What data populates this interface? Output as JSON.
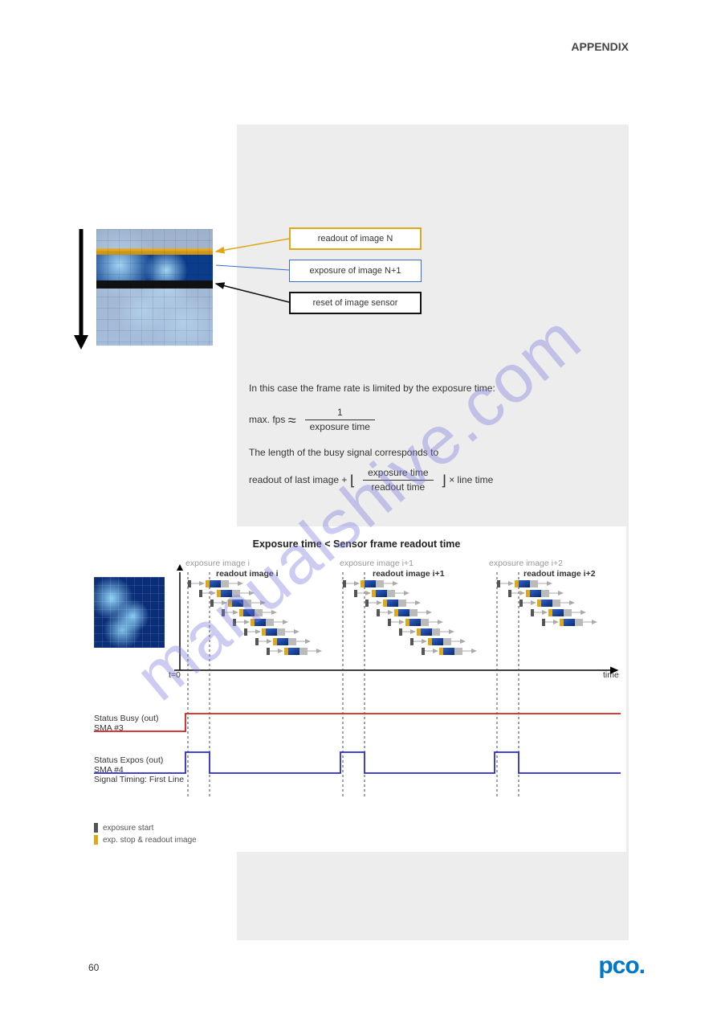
{
  "header": {
    "title": "APPENDIX"
  },
  "watermark": "manualshive.com",
  "diagram": {
    "labels": {
      "readout": "readout of image N",
      "exposure": "exposure of image N+1",
      "reset": "reset of image sensor"
    }
  },
  "body": {
    "para1": "In this case the frame rate is limited by the exposure time:",
    "eq1_lhs": "max. fps",
    "eq1_frac_n": "1",
    "eq1_frac_d": "exposure time",
    "para2": "The length of the busy signal corresponds to",
    "eq2_sum_pre": "readout of last image + ",
    "eq2_frac_n": "exposure time",
    "eq2_frac_d": "readout time",
    "eq2_mult": " × line time"
  },
  "chart": {
    "title": "Exposure time < Sensor frame readout time",
    "exposure_labels": [
      "exposure image i",
      "exposure image i+1",
      "exposure image i+2"
    ],
    "readout_labels": [
      "readout image i",
      "readout image i+1",
      "readout image i+2"
    ],
    "axis": {
      "t0": "t=0",
      "time": "time"
    },
    "signals": {
      "busy": {
        "label1": "Status Busy (out)",
        "label2": "SMA #3"
      },
      "expos": {
        "label1": "Status Expos (out)",
        "label2": "SMA #4",
        "label3": "Signal Timing: First Line"
      }
    },
    "legend": {
      "exp_start": "exposure start",
      "exp_stop": "exp. stop & readout image"
    }
  },
  "footer": {
    "page": "60",
    "logo": "pco."
  }
}
